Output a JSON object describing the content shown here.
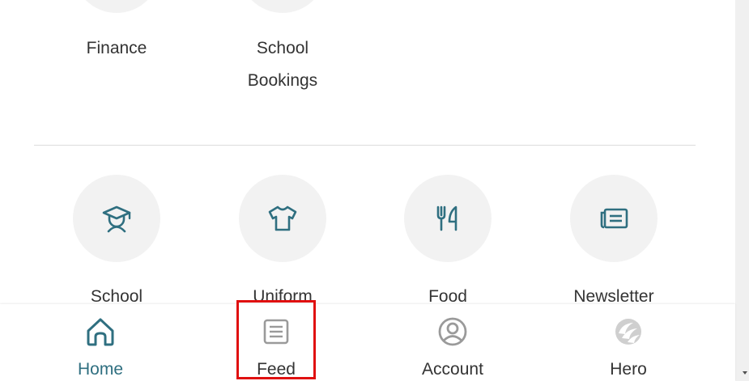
{
  "colors": {
    "icon_teal": "#2f6f80",
    "nav_home": "#2f6f80",
    "nav_inactive": "#9a9a9a",
    "text": "#333333",
    "highlight": "#e01010"
  },
  "top_tiles": [
    {
      "label_line1": "Finance",
      "label_line2": ""
    },
    {
      "label_line1": "School",
      "label_line2": "Bookings"
    }
  ],
  "tiles": [
    {
      "icon": "graduate-icon",
      "label": "School"
    },
    {
      "icon": "tshirt-icon",
      "label": "Uniform"
    },
    {
      "icon": "fork-knife-icon",
      "label": "Food"
    },
    {
      "icon": "newspaper-icon",
      "label": "Newsletter"
    }
  ],
  "bottom_nav": {
    "items": [
      {
        "label": "Home",
        "icon": "home-icon",
        "active": true
      },
      {
        "label": "Feed",
        "icon": "feed-icon",
        "active": false
      },
      {
        "label": "Account",
        "icon": "account-icon",
        "active": false
      },
      {
        "label": "Hero",
        "icon": "hero-logo-icon",
        "active": false
      }
    ]
  }
}
